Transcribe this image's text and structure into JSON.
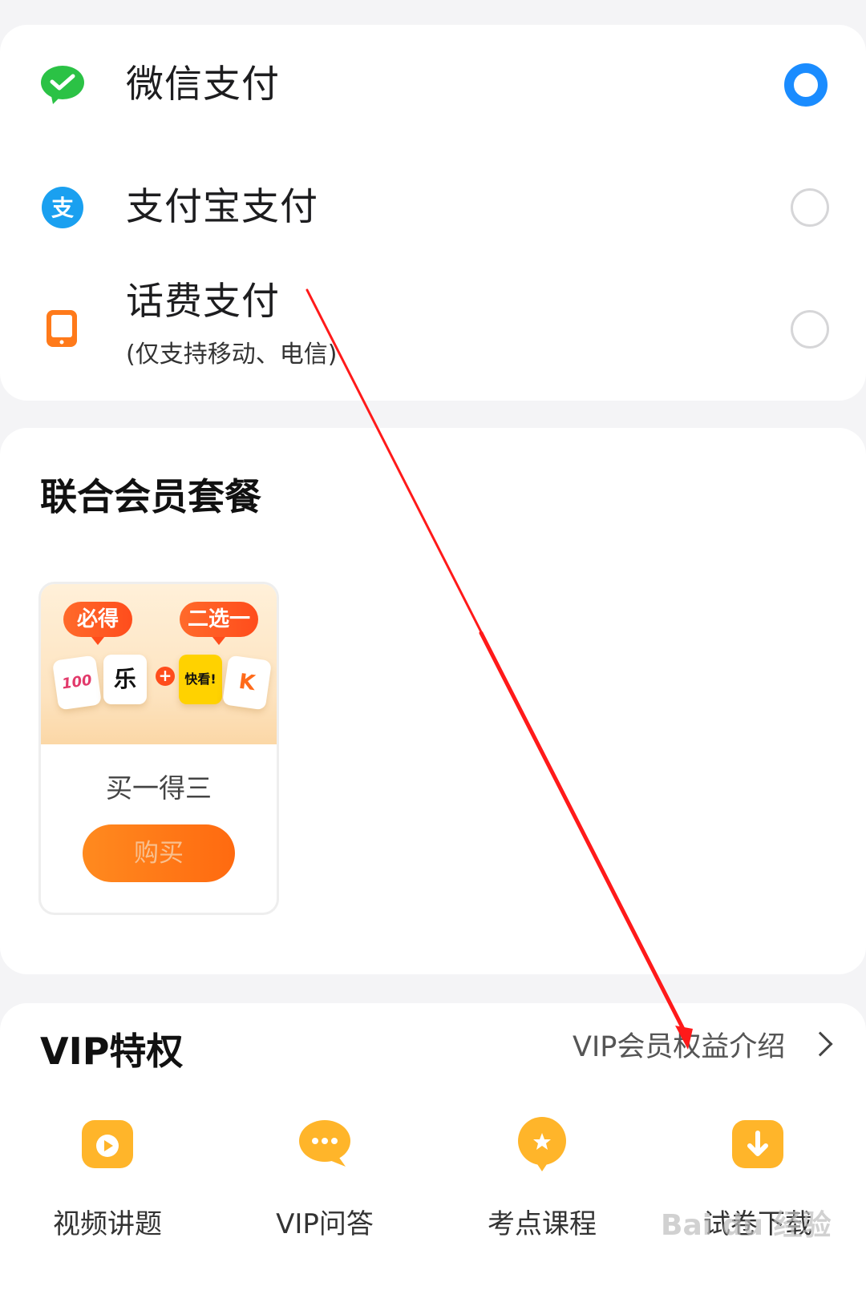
{
  "payment": {
    "options": [
      {
        "label": "微信支付",
        "selected": true,
        "icon": "wechat-icon",
        "color": "#2bc245"
      },
      {
        "label": "支付宝支付",
        "selected": false,
        "icon": "alipay-icon",
        "color": "#1aa0f0"
      },
      {
        "label": "话费支付",
        "sub": "(仅支持移动、电信)",
        "selected": false,
        "icon": "phone-icon",
        "color": "#ff7a1a"
      }
    ]
  },
  "combo": {
    "title": "联合会员套餐",
    "item": {
      "tag_must": "必得",
      "tag_pick": "二选一",
      "apps": [
        "100",
        "乐",
        "快看!",
        "K"
      ],
      "name": "买一得三",
      "buy_label": "购买"
    }
  },
  "vip": {
    "title": "VIP特权",
    "intro_link": "VIP会员权益介绍",
    "features": [
      {
        "label": "视频讲题",
        "icon": "video-icon"
      },
      {
        "label": "VIP问答",
        "icon": "chat-icon"
      },
      {
        "label": "考点课程",
        "icon": "star-icon"
      },
      {
        "label": "试卷下载",
        "icon": "download-icon"
      }
    ]
  },
  "watermark": "Bai du 经验",
  "colors": {
    "accent_blue": "#1a8cff",
    "accent_orange": "#ff7a1a",
    "annotation_red": "#ff1a1a"
  }
}
